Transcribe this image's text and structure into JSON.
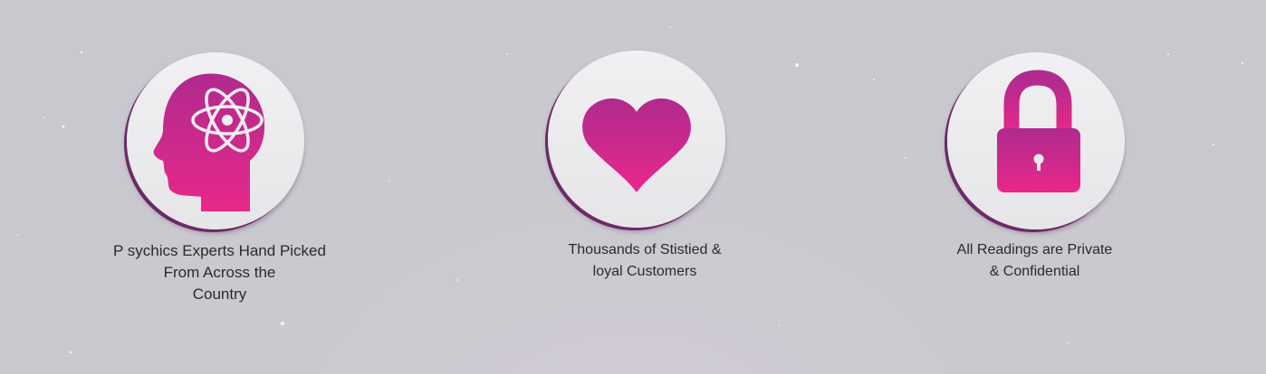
{
  "features": [
    {
      "icon": "head-atom-icon",
      "caption": "P sychics  Experts Hand Picked\nFrom Across the\nCountry"
    },
    {
      "icon": "heart-icon",
      "caption": "Thousands of Stistied &\nloyal Customers"
    },
    {
      "icon": "padlock-icon",
      "caption": "All Readings are Private\n& Confidential"
    }
  ],
  "colors": {
    "icon_gradient_top": "#b02a8e",
    "icon_gradient_bottom": "#e8288a",
    "circle_shadow": "#6b2a68"
  }
}
